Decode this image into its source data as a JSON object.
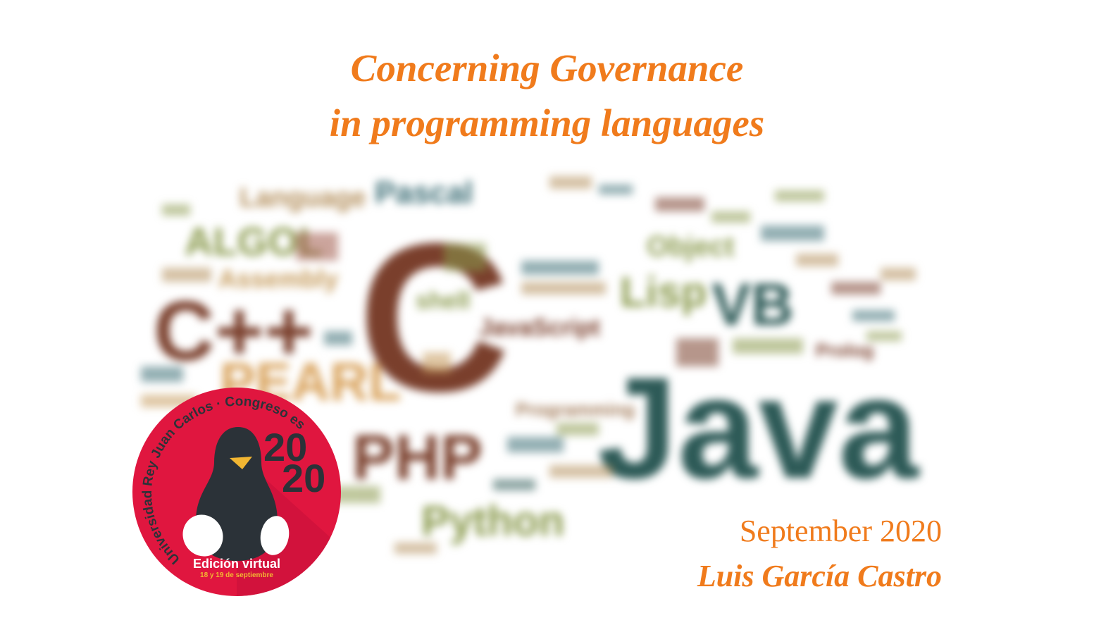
{
  "slide": {
    "title_line1": "Concerning Governance",
    "title_line2": "in programming languages",
    "date": "September 2020",
    "author": "Luis García Castro",
    "accent_color": "#f07b1c"
  },
  "word_cloud": {
    "words": [
      "Java",
      "C",
      "C++",
      "PHP",
      "Python",
      "VB",
      "Lisp",
      "ALGOL",
      "Pascal",
      "Language",
      "Assembly",
      "Object",
      "JavaScript",
      "PEARL",
      "shell",
      "Programming",
      "Prolog"
    ]
  },
  "badge": {
    "arc_text": "Universidad Rey Juan Carlos · Congreso esLibre",
    "year_top": "20",
    "year_bottom": "20",
    "edition": "Edición virtual",
    "dates": "18 y 19 de septiembre",
    "colors": {
      "background": "#e0163f",
      "penguin": "#2b3238",
      "beak": "#f2b632",
      "year": "#2b3238"
    },
    "icon": "penguin-icon"
  }
}
